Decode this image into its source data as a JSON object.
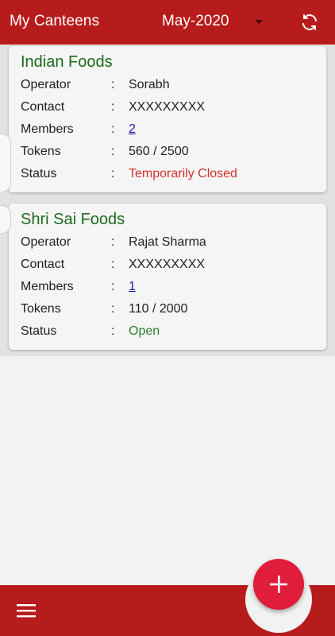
{
  "appbar": {
    "title": "My Canteens",
    "month": "May-2020"
  },
  "icons": {
    "refresh": "refresh-icon",
    "dropdown": "caret-down-icon",
    "add": "plus-icon",
    "menu": "hamburger-menu-icon"
  },
  "colors": {
    "primary": "#b71c1c",
    "fab": "#e01e3c",
    "title_green": "#1b6b1b",
    "status_closed": "#d32f2f",
    "status_open": "#2e7d32"
  },
  "labels": {
    "operator": "Operator",
    "contact": "Contact",
    "members": "Members",
    "tokens": "Tokens",
    "status": "Status",
    "separator": ":"
  },
  "canteens": [
    {
      "name": "Indian Foods",
      "operator": "Sorabh",
      "contact": "XXXXXXXXX",
      "members": "2",
      "tokens": "560 / 2500",
      "status": "Temporarily Closed"
    },
    {
      "name": "Shri Sai Foods",
      "operator": "Rajat Sharma",
      "contact": "XXXXXXXXX",
      "members": "1",
      "tokens": "110 / 2000",
      "status": "Open"
    }
  ]
}
